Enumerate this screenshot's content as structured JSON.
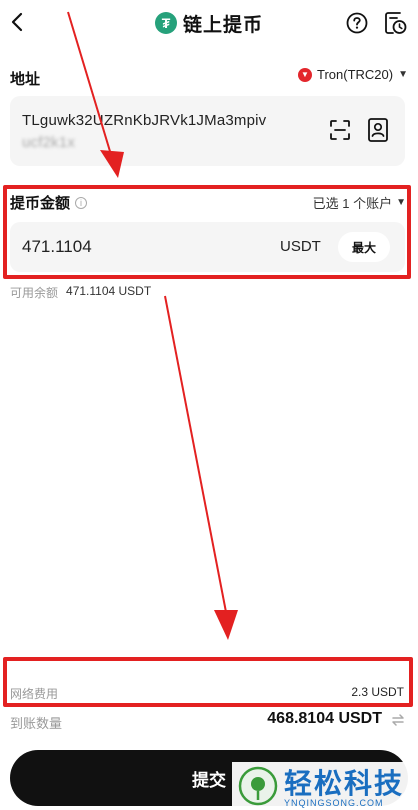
{
  "header": {
    "title": "链上提币",
    "token_logo": "₮",
    "icons": [
      "back-arrow-icon",
      "help-icon",
      "history-icon"
    ]
  },
  "address": {
    "label": "地址",
    "network": "Tron(TRC20)",
    "value": "TLguwk32UZRnKbJRVk1JMa3mpiv",
    "value_tail": "ucf2k1x",
    "icons": [
      "scan-icon",
      "address-book-icon"
    ]
  },
  "amount": {
    "label": "提币金额",
    "accounts": "已选 1 个账户",
    "value": "471.1104",
    "unit": "USDT",
    "max_label": "最大",
    "available_label": "可用余额",
    "available_value": "471.1104 USDT"
  },
  "fee": {
    "label": "网络费用",
    "value": "2.3 USDT"
  },
  "receive": {
    "label": "到账数量",
    "value": "468.8104 USDT"
  },
  "submit": {
    "label": "提交"
  },
  "watermark": {
    "cn": "轻松科技",
    "en": "YNQINGSONG.COM"
  },
  "colors": {
    "highlight": "#e32121",
    "usdt": "#26a17b",
    "tron": "#e3262c",
    "button": "#111111",
    "watermark": "#1a6ec0"
  }
}
